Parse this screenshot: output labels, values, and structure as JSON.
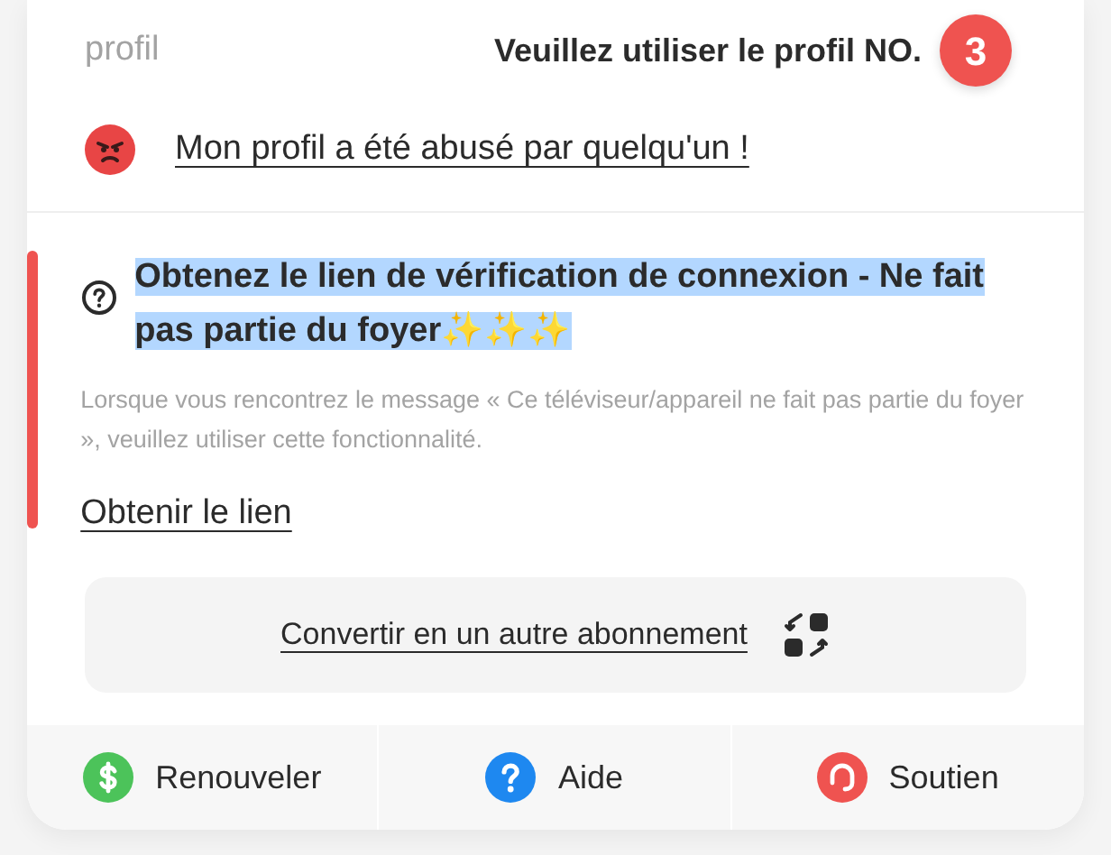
{
  "profile": {
    "label": "profil",
    "instruction": "Veuillez utiliser le profil NO.",
    "number": "3"
  },
  "abuse_link": "Mon profil a été abusé par quelqu'un !",
  "verification": {
    "title": "Obtenez le lien de vérification de connexion - Ne fait pas partie du foyer✨✨✨",
    "title_selected": true,
    "description": "Lorsque vous rencontrez le message « Ce téléviseur/appareil ne fait pas partie du foyer », veuillez utiliser cette fonctionnalité.",
    "link": "Obtenir le lien"
  },
  "convert_button": "Convertir en un autre abonnement",
  "footer": [
    {
      "kind": "renew",
      "label": "Renouveler",
      "color": "#4cc35a"
    },
    {
      "kind": "help",
      "label": "Aide",
      "color": "#1e88f0"
    },
    {
      "kind": "support",
      "label": "Soutien",
      "color": "#ef5350"
    }
  ]
}
